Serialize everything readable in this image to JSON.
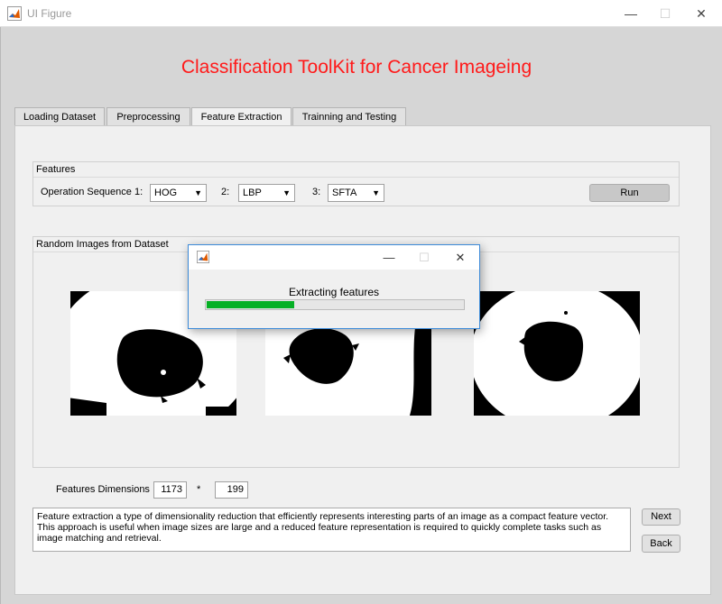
{
  "window": {
    "title": "UI Figure",
    "minimize": "—",
    "maximize": "☐",
    "close": "✕"
  },
  "app_title": "Classification ToolKit for Cancer Imageing",
  "tabs": [
    {
      "label": "Loading Dataset",
      "active": false
    },
    {
      "label": "Preprocessing",
      "active": false
    },
    {
      "label": "Feature Extraction",
      "active": true
    },
    {
      "label": "Trainning and Testing",
      "active": false
    }
  ],
  "features_panel": {
    "title": "Features",
    "sequence_label": "Operation Sequence 1:",
    "select1": "HOG",
    "label2": "2:",
    "select2": "LBP",
    "label3": "3:",
    "select3": "SFTA",
    "run_button": "Run"
  },
  "images_panel": {
    "title": "Random Images from Dataset"
  },
  "dimensions": {
    "label": "Features Dimensions",
    "rows": "1173",
    "separator": "*",
    "cols": "199"
  },
  "description": "Feature extraction a type of dimensionality reduction that efficiently represents interesting parts of an image as a compact feature vector. This approach is useful when image sizes are large and a reduced feature representation is required to quickly complete tasks such as image matching and retrieval.",
  "next_button": "Next",
  "back_button": "Back",
  "dialog": {
    "message": "Extracting features",
    "minimize": "—",
    "maximize": "☐",
    "close": "✕",
    "progress": 0.34,
    "progress_color": "#06b025"
  },
  "icons": {
    "app": "matlab-icon"
  }
}
